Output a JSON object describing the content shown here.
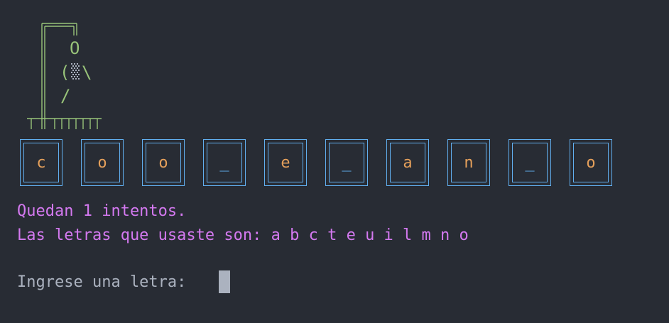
{
  "hangman": {
    "head": "O",
    "arm_left": "(",
    "arm_right": "\\",
    "leg": "/"
  },
  "word_tiles": [
    "c",
    "o",
    "o",
    "_",
    "e",
    "_",
    "a",
    "n",
    "_",
    "o"
  ],
  "status": {
    "attempts_left": "Quedan 1 intentos.",
    "used_letters": "Las letras que usaste son: a b c t e u i l m n o"
  },
  "prompt": {
    "label": "Ingrese una letra: "
  },
  "colors": {
    "background": "#282c34",
    "gallows": "#98c379",
    "tile_border": "#61afef",
    "letter": "#e5a05b",
    "status_text": "#d479f0",
    "prompt_text": "#abb2bf"
  }
}
